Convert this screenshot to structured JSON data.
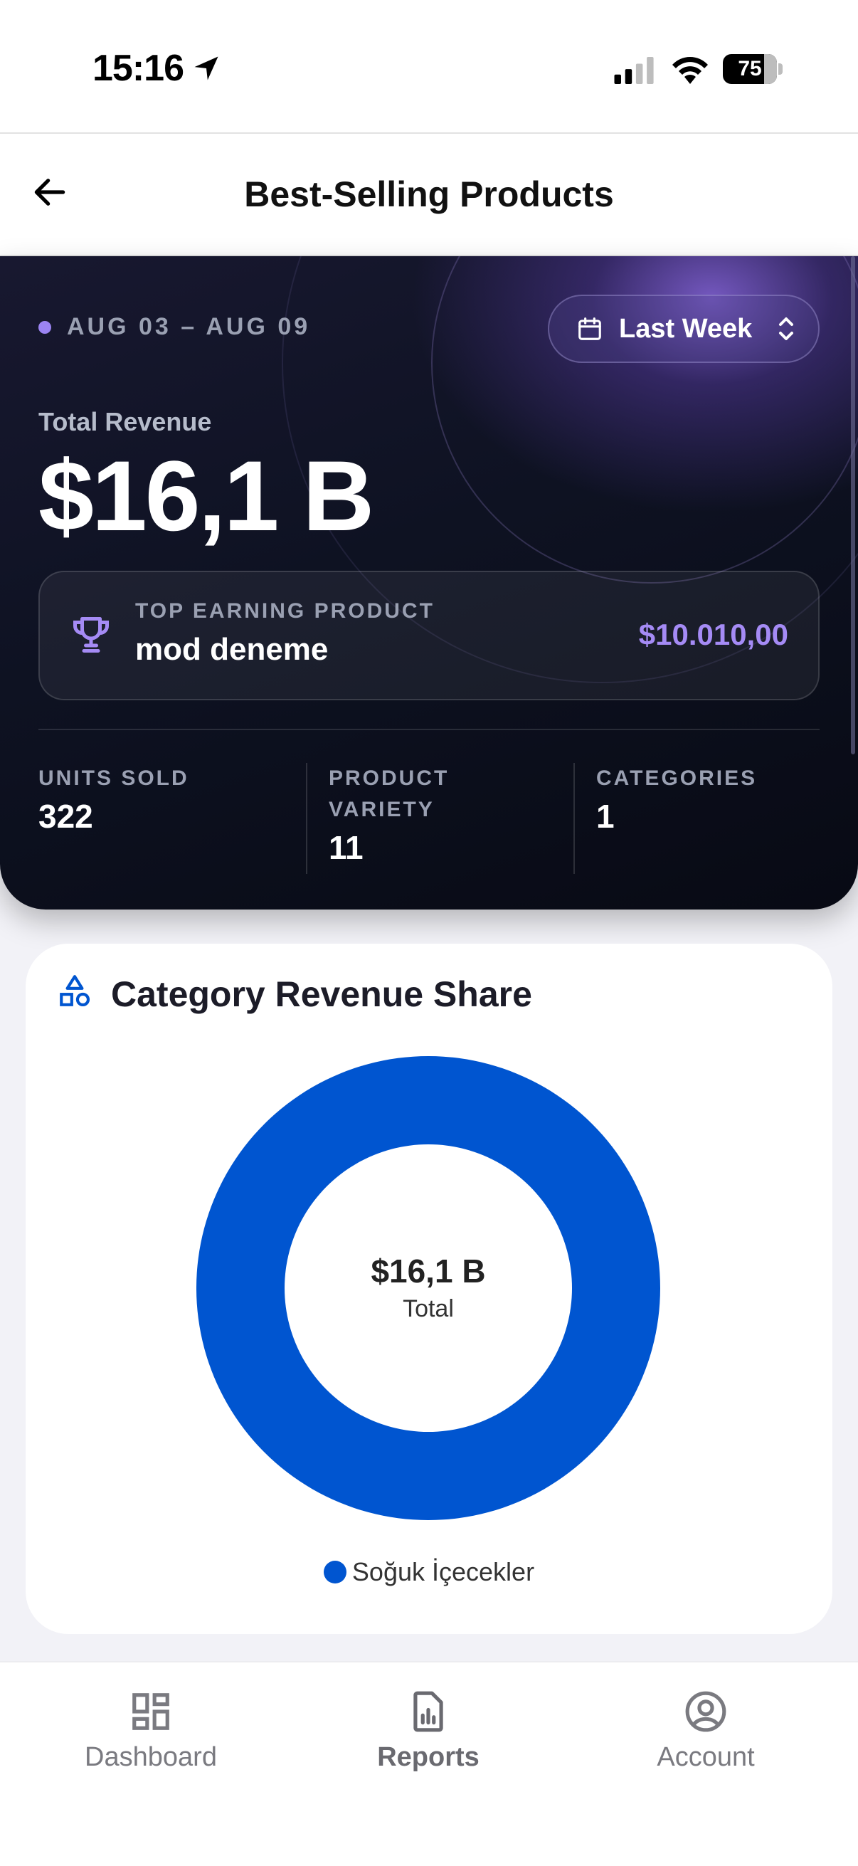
{
  "status_bar": {
    "time": "15:16",
    "battery": "75"
  },
  "header": {
    "title": "Best-Selling Products"
  },
  "hero": {
    "date_range": "AUG 03 – AUG 09",
    "period_label": "Last Week",
    "revenue_label": "Total Revenue",
    "revenue_value": "$16,1 B",
    "top_product": {
      "label": "TOP EARNING PRODUCT",
      "name": "mod deneme",
      "amount": "$10.010,00"
    },
    "stats": [
      {
        "label": "UNITS SOLD",
        "value": "322"
      },
      {
        "label": "PRODUCT VARIETY",
        "value": "11"
      },
      {
        "label": "CATEGORIES",
        "value": "1"
      }
    ]
  },
  "category_card": {
    "title": "Category Revenue Share",
    "center_value": "$16,1 B",
    "center_label": "Total"
  },
  "chart_data": {
    "type": "pie",
    "categories": [
      "Soğuk İçecekler"
    ],
    "values": [
      100
    ],
    "colors": [
      "#0055d0"
    ]
  },
  "nav": {
    "items": [
      {
        "label": "Dashboard",
        "icon": "dashboard-icon"
      },
      {
        "label": "Reports",
        "icon": "reports-icon"
      },
      {
        "label": "Account",
        "icon": "account-icon"
      }
    ]
  },
  "colors": {
    "accent_purple": "#a58bf5",
    "chart_blue": "#0055d0"
  }
}
